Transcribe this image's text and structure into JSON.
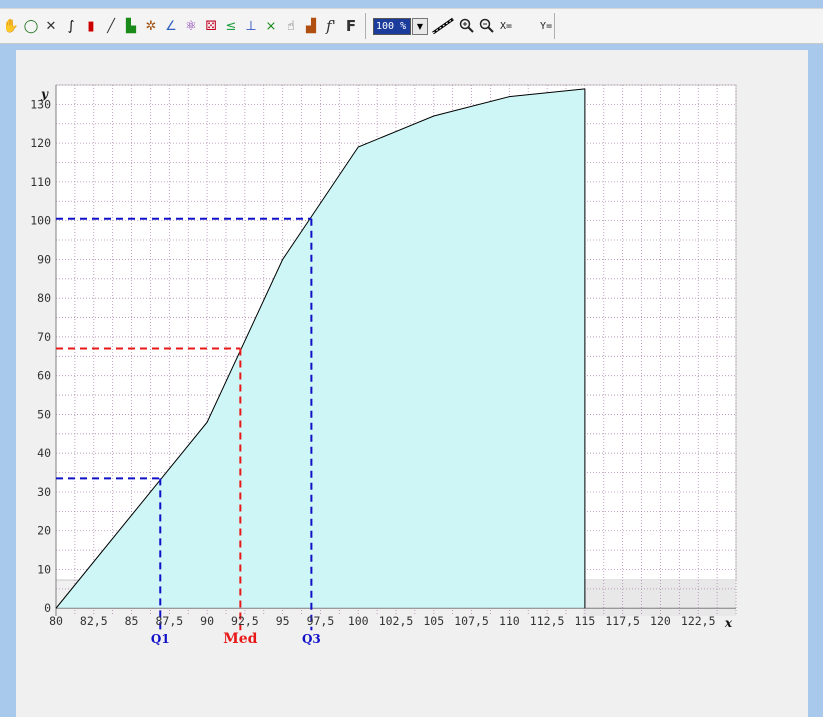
{
  "toolbar": {
    "tools": [
      "hand-tool-icon",
      "circle-tool-icon",
      "axes-tool-icon",
      "curve-tool-icon",
      "bar-tool-icon",
      "line-tool-icon",
      "histogram-tool-icon",
      "butterfly-tool-icon",
      "angle-tool-icon",
      "atom-tool-icon",
      "dice-tool-icon",
      "less-than-tool-icon",
      "segment-tool-icon",
      "intersection-tool-icon",
      "hand-point-tool-icon",
      "stairs-tool-icon"
    ],
    "f_prime": "f'",
    "f_label": "F",
    "zoom_value": "100 %",
    "x_label": "X=",
    "y_label": "Y="
  },
  "chart_data": {
    "type": "area",
    "xlabel": "x",
    "ylabel": "y",
    "xlim": [
      80,
      125
    ],
    "ylim": [
      -2,
      135
    ],
    "grid": true,
    "x_ticks": [
      80,
      82.5,
      85,
      87.5,
      90,
      92.5,
      95,
      97.5,
      100,
      102.5,
      105,
      107.5,
      110,
      112.5,
      115,
      117.5,
      120,
      122.5
    ],
    "x_tick_labels": [
      "80",
      "82,5",
      "85",
      "87,5",
      "90",
      "92,5",
      "95",
      "97,5",
      "100",
      "102,5",
      "105",
      "107,5",
      "110",
      "112,5",
      "115",
      "117,5",
      "120",
      "122,5"
    ],
    "y_ticks": [
      0,
      10,
      20,
      30,
      40,
      50,
      60,
      70,
      80,
      90,
      100,
      110,
      120,
      130
    ],
    "series": [
      {
        "type": "cumulative-frequency-polygon",
        "x": [
          80,
          90,
          95,
          100,
          105,
          110,
          115
        ],
        "y": [
          0,
          48,
          90,
          119,
          127,
          132,
          134
        ],
        "line_color": "#000000",
        "fill_color": "#cef6f6"
      }
    ],
    "markers": [
      {
        "label": "Q1",
        "x": 86.9,
        "y": 33.5,
        "color": "#1010c8"
      },
      {
        "label": "Med",
        "x": 92.2,
        "y": 67,
        "color": "#e81818"
      },
      {
        "label": "Q3",
        "x": 96.9,
        "y": 100.5,
        "color": "#1010c8"
      }
    ],
    "colors": {
      "grid": "#a070a0",
      "axis": "#808080",
      "plot_bg": "#ffffff"
    }
  }
}
